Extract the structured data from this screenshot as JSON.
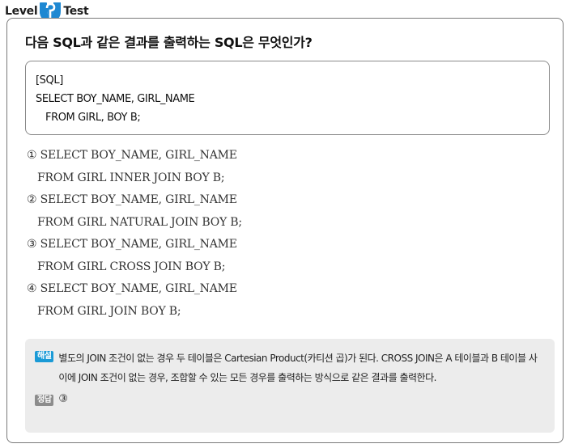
{
  "header": {
    "logo_left": "Level",
    "logo_right": "Test"
  },
  "question": "다음 SQL과 같은 결과를 출력하는 SQL은 무엇인가?",
  "sql_box": {
    "label": "[SQL]",
    "line1": "SELECT BOY_NAME, GIRL_NAME",
    "line2": "FROM GIRL, BOY B;"
  },
  "options": [
    {
      "marker": "①",
      "line1": "SELECT BOY_NAME, GIRL_NAME",
      "line2": "FROM GIRL INNER JOIN BOY B;"
    },
    {
      "marker": "②",
      "line1": "SELECT BOY_NAME, GIRL_NAME",
      "line2": "FROM GIRL NATURAL JOIN BOY B;"
    },
    {
      "marker": "③",
      "line1": "SELECT BOY_NAME, GIRL_NAME",
      "line2": "FROM GIRL CROSS JOIN BOY B;"
    },
    {
      "marker": "④",
      "line1": "SELECT BOY_NAME, GIRL_NAME",
      "line2": "FROM GIRL JOIN BOY B;"
    }
  ],
  "explanation": {
    "tag": "해설",
    "text": "별도의 JOIN 조건이 없는 경우 두 테이블은 Cartesian Product(카티션 곱)가 된다. CROSS JOIN은 A 테이블과 B 테이블 사이에 JOIN 조건이 없는 경우, 조합할 수 있는 모든 경우를 출력하는 방식으로 같은 결과를 출력한다."
  },
  "answer": {
    "tag": "정답",
    "value": "③"
  },
  "colors": {
    "tag_blue": "#1a9ad6",
    "tag_gray": "#8c8c8c",
    "panel_bg": "#ececec",
    "logo_blue": "#1e88d2"
  }
}
